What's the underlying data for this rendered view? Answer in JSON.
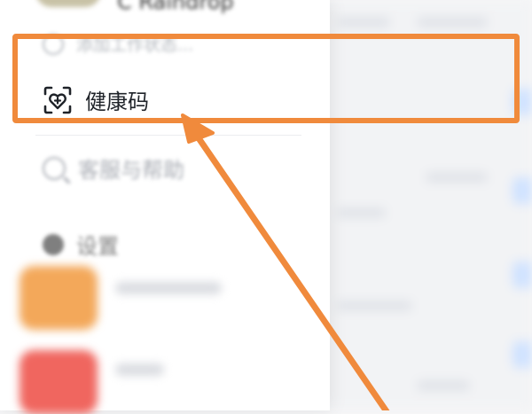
{
  "menu": {
    "user_name": "C Raindrop",
    "status_placeholder": "添加工作状态...",
    "health_code_label": "健康码",
    "help_label": "客服与帮助",
    "settings_label": "设置"
  },
  "annotation": {
    "highlight_color": "#f08a3c"
  }
}
